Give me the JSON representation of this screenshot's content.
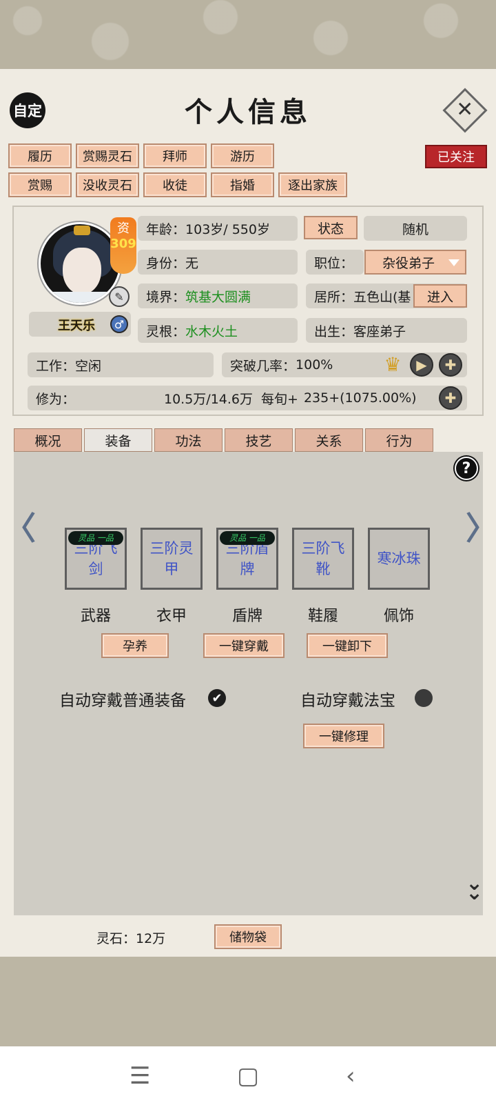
{
  "header": {
    "custom_label": "自定",
    "title": "个人信息",
    "close_icon": "close-icon"
  },
  "actions_row1": [
    "履历",
    "赏赐灵石",
    "拜师",
    "游历"
  ],
  "actions_row2": [
    "赏赐",
    "没收灵石",
    "收徒",
    "指婚",
    "逐出家族"
  ],
  "follow_label": "已关注",
  "character": {
    "talent_label": "资",
    "talent_value": "309",
    "name": "王天乐",
    "gender_icon": "male-icon",
    "age_label": "年龄：",
    "age_value": "103岁/ 550岁",
    "state_button": "状态",
    "random_label": "随机",
    "identity_label": "身份：",
    "identity_value": "无",
    "position_label": "职位：",
    "position_value": "杂役弟子",
    "realm_label": "境界：",
    "realm_value": "筑基大圆满",
    "residence_label": "居所：",
    "residence_value": "五色山(基",
    "enter_button": "进入",
    "root_label": "灵根：",
    "root_value": "水木火土",
    "birth_label": "出生：",
    "birth_value": "客座弟子",
    "work_label": "工作：",
    "work_value": "空闲",
    "breakthrough_label": "突破几率：",
    "breakthrough_value": "100%",
    "cultivation_label": "修为：",
    "cultivation_value": "10.5万/14.6万",
    "per_turn_label": "每旬+",
    "per_turn_value": "235+(1075.00%)"
  },
  "tabs": [
    "概况",
    "装备",
    "功法",
    "技艺",
    "关系",
    "行为"
  ],
  "active_tab": "装备",
  "equipment": {
    "slots": [
      {
        "item": "三阶飞剑",
        "label": "武器",
        "badge": "灵品 一品"
      },
      {
        "item": "三阶灵甲",
        "label": "衣甲",
        "badge": ""
      },
      {
        "item": "三阶盾牌",
        "label": "盾牌",
        "badge": "灵品 一品"
      },
      {
        "item": "三阶飞靴",
        "label": "鞋履",
        "badge": ""
      },
      {
        "item": "寒冰珠",
        "label": "佩饰",
        "badge": ""
      }
    ],
    "nurture_button": "孕养",
    "equip_all_button": "一键穿戴",
    "unequip_all_button": "一键卸下",
    "auto_normal_label": "自动穿戴普通装备",
    "auto_normal_checked": true,
    "auto_treasure_label": "自动穿戴法宝",
    "auto_treasure_checked": false,
    "repair_button": "一键修理"
  },
  "footer": {
    "spirit_stone_label": "灵石：12万",
    "bag_button": "储物袋"
  }
}
